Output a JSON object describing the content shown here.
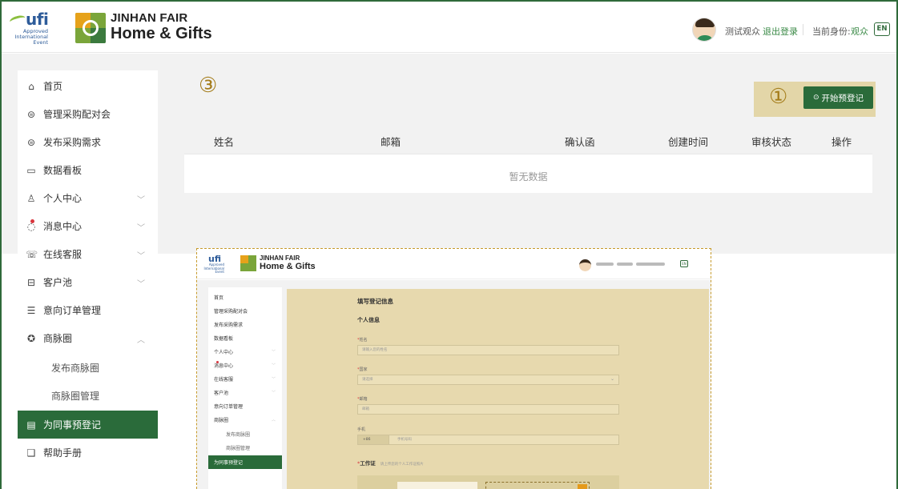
{
  "header": {
    "ufi_word": "ufi",
    "ufi_sub": "Approved International Event",
    "fair_title_line1": "JINHAN FAIR",
    "fair_title_line2": "Home & Gifts",
    "user_name": "测试观众",
    "logout": "退出登录",
    "role_label": "当前身份:",
    "role_value": "观众",
    "lang_button": "EN"
  },
  "sidebar": {
    "items": [
      {
        "label": "首页",
        "icon": "home-icon"
      },
      {
        "label": "管理采购配对会",
        "icon": "database-icon"
      },
      {
        "label": "发布采购需求",
        "icon": "database-icon"
      },
      {
        "label": "数据看板",
        "icon": "dashboard-icon"
      },
      {
        "label": "个人中心",
        "icon": "user-icon"
      },
      {
        "label": "消息中心",
        "icon": "message-icon"
      },
      {
        "label": "在线客服",
        "icon": "headset-icon"
      },
      {
        "label": "客户池",
        "icon": "inbox-icon"
      },
      {
        "label": "意向订单管理",
        "icon": "order-icon"
      },
      {
        "label": "商脉圈",
        "icon": "network-icon"
      },
      {
        "label": "发布商脉圈",
        "icon": ""
      },
      {
        "label": "商脉圈管理",
        "icon": ""
      },
      {
        "label": "为同事预登记",
        "icon": "register-icon"
      },
      {
        "label": "帮助手册",
        "icon": "book-icon"
      }
    ]
  },
  "annotations": {
    "circle_three": "③",
    "circle_one": "①"
  },
  "main": {
    "start_button": "开始预登记",
    "columns": [
      "姓名",
      "邮箱",
      "确认函",
      "创建时间",
      "审核状态",
      "操作"
    ],
    "empty_text": "暂无数据"
  },
  "inset": {
    "ufi_word": "ufi",
    "ufi_sub": "Approved International Event",
    "title1": "JINHAN FAIR",
    "title2": "Home & Gifts",
    "lang": "EN",
    "side": [
      "首页",
      "管理采购配对会",
      "发布采购需求",
      "数据看板",
      "个人中心",
      "消息中心",
      "在线客服",
      "客户池",
      "意向订单管理",
      "商脉圈",
      "发布商脉圈",
      "商脉圈管理",
      "为同事预登记"
    ],
    "form_title": "填写登记信息",
    "section_title": "个人信息",
    "labels": [
      "姓名",
      "国家",
      "邮箱",
      "手机"
    ],
    "placeholders": [
      "请输入您的姓名",
      "请选择",
      "邮箱",
      "手机号码"
    ],
    "phone_prefix": "+86",
    "work_label": "工作证",
    "work_hint": "请上传您的个人工作证照片"
  },
  "colors": {
    "brand_green": "#2a6b3a",
    "accent_gold": "#a47c1a",
    "highlight": "#e3d6a8"
  }
}
